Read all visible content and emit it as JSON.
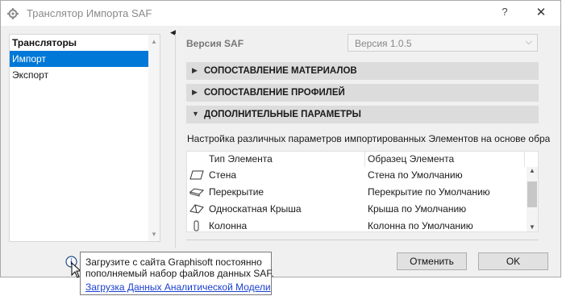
{
  "window": {
    "title": "Транслятор Импорта SAF",
    "help_label": "?",
    "close_label": "✕"
  },
  "sidebar": {
    "header": "Трансляторы",
    "items": [
      {
        "label": "Импорт",
        "selected": true
      },
      {
        "label": "Экспорт",
        "selected": false
      }
    ]
  },
  "version": {
    "label": "Версия SAF",
    "value": "Версия 1.0.5"
  },
  "sections": [
    {
      "label": "СОПОСТАВЛЕНИЕ МАТЕРИАЛОВ",
      "expanded": false
    },
    {
      "label": "СОПОСТАВЛЕНИЕ ПРОФИЛЕЙ",
      "expanded": false
    },
    {
      "label": "ДОПОЛНИТЕЛЬНЫЕ ПАРАМЕТРЫ",
      "expanded": true
    }
  ],
  "description": "Настройка различных параметров импортированных Элементов на основе образц",
  "table": {
    "columns": [
      "Тип Элемента",
      "Образец Элемента"
    ],
    "rows": [
      {
        "icon": "wall-icon",
        "type": "Стена",
        "sample": "Стена по Умолчанию"
      },
      {
        "icon": "slab-icon",
        "type": "Перекрытие",
        "sample": "Перекрытие по Умолчанию"
      },
      {
        "icon": "roof-icon",
        "type": "Односкатная Крыша",
        "sample": "Крыша по Умолчанию"
      },
      {
        "icon": "column-icon",
        "type": "Колонна",
        "sample": "Колонна по Умолчанию"
      }
    ]
  },
  "buttons": {
    "cancel": "Отменить",
    "ok": "OK"
  },
  "tooltip": {
    "line1": "Загрузите с сайта Graphisoft постоянно",
    "line2": "пополняемый набор файлов данных SAF.",
    "link": "Загрузка Данных Аналитической Модели"
  },
  "colors": {
    "selection": "#0078d7",
    "section_bg": "#dcdcdc",
    "link": "#1a3fd0"
  }
}
